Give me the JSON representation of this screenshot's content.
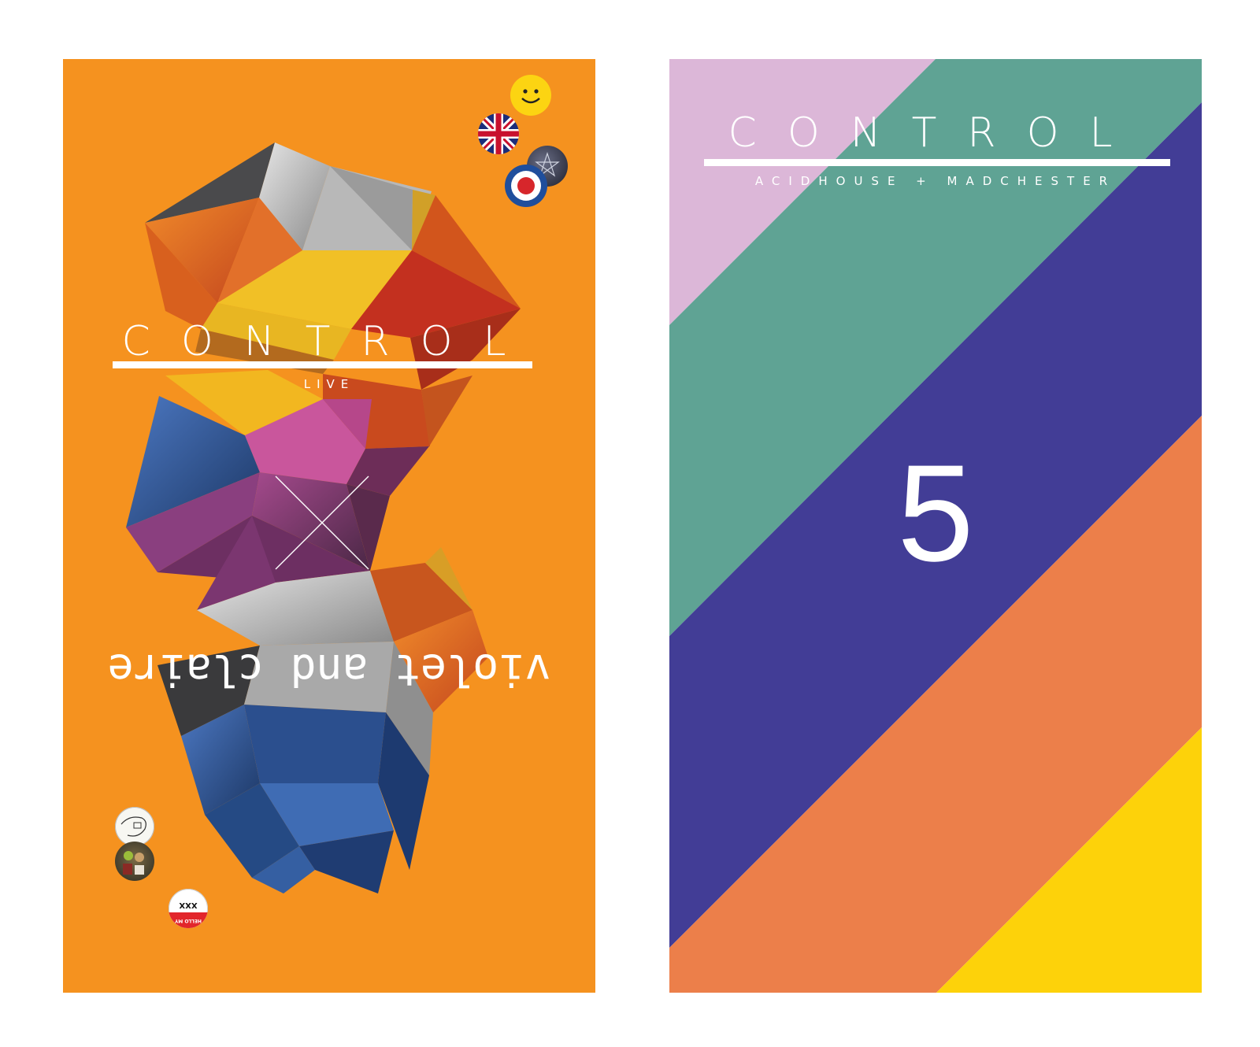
{
  "left_poster": {
    "title": "CONTROL",
    "subtitle": "LIVE",
    "upside_down_text": "violet and claire",
    "background_color": "#f5921f",
    "badges": {
      "smiley": "smiley-badge",
      "union_jack": "union-jack-badge",
      "pentagram": "pentagram-badge",
      "mod_target": "mod-target-badge",
      "sketch": "sketch-badge",
      "band_photo": "band-photo-badge",
      "hello": {
        "line1": "XXX",
        "line2": "HELLO MY NAME IS"
      }
    }
  },
  "right_poster": {
    "title": "CONTROL",
    "subtitle": "ACIDHOUSE + MADCHESTER",
    "number": "5",
    "stripe_colors": [
      "#dcb7d8",
      "#5fa394",
      "#423d96",
      "#ec7f4a",
      "#fdd20a"
    ]
  }
}
